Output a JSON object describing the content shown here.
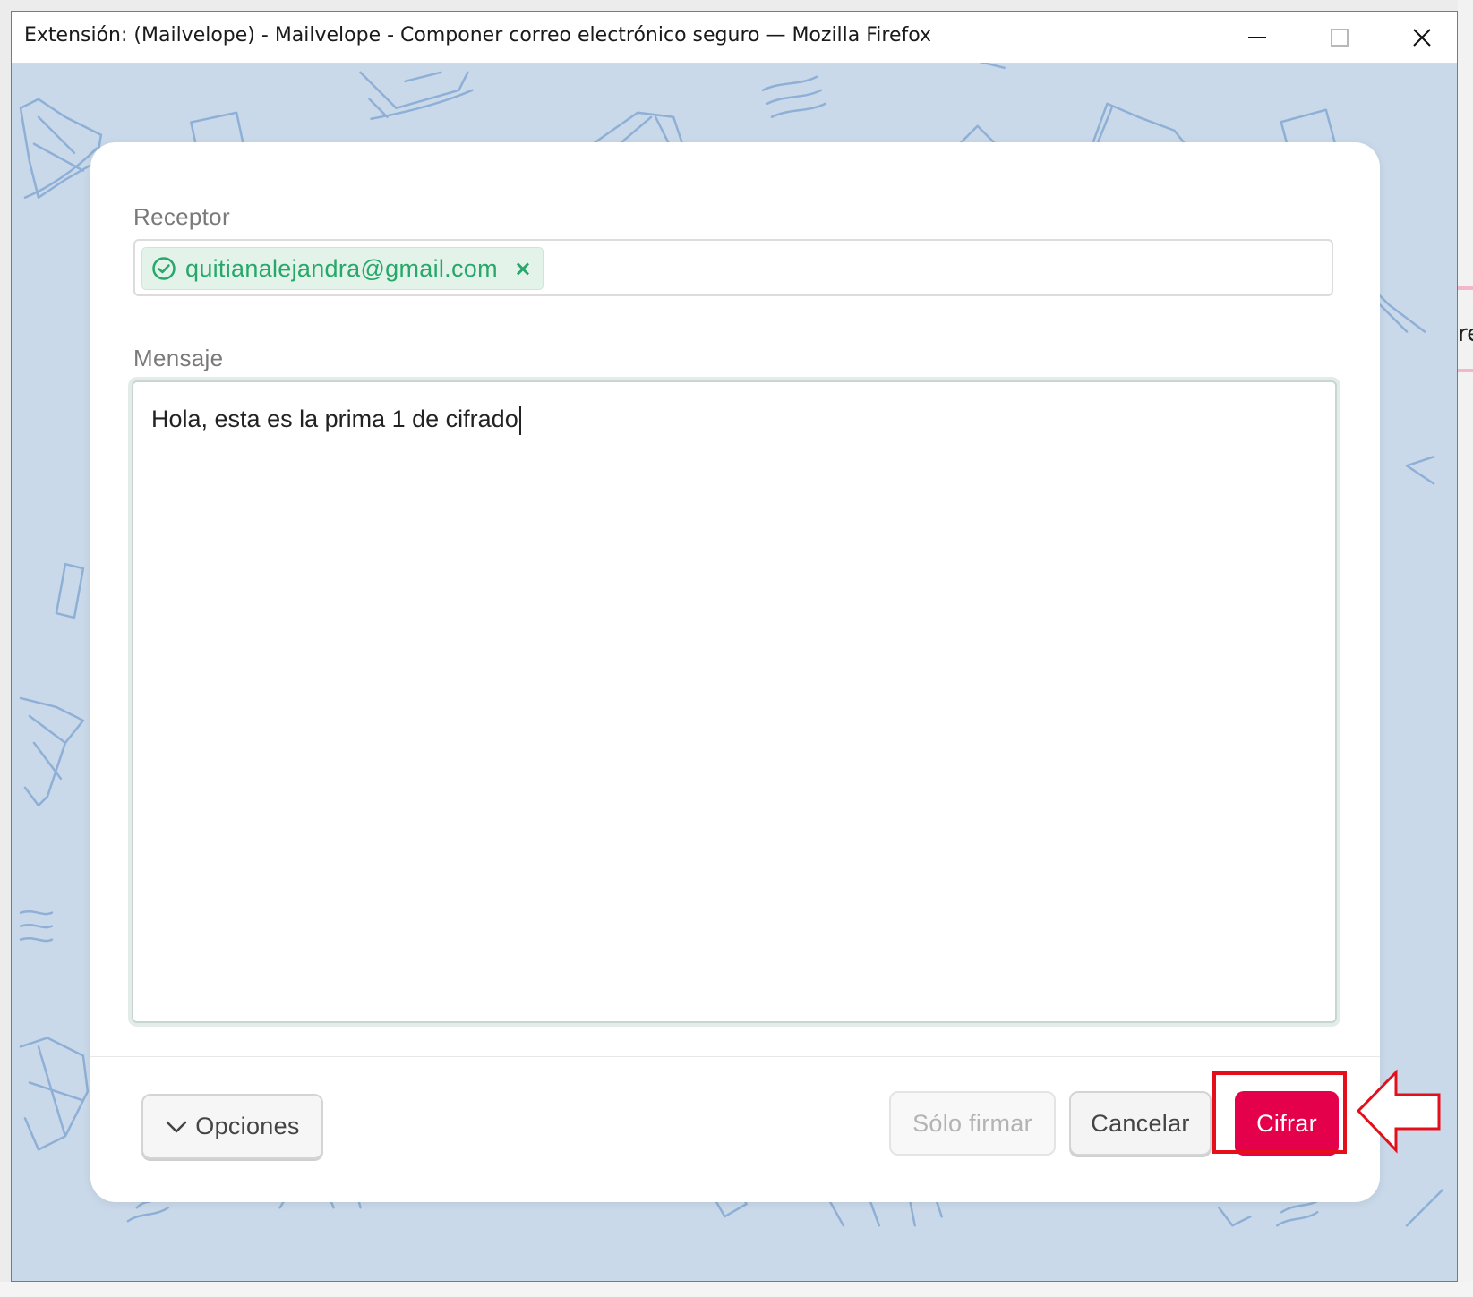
{
  "window": {
    "title": "Extensión: (Mailvelope) - Mailvelope - Componer correo electrónico seguro — Mozilla Firefox",
    "controls": {
      "minimize_icon": "minimize-icon",
      "maximize_icon": "maximize-icon",
      "close_icon": "close-icon"
    }
  },
  "background_partial_text": "re",
  "form": {
    "recipient_label": "Receptor",
    "recipients": [
      {
        "email": "quitianalejandra@gmail.com",
        "verified": true
      }
    ],
    "message_label": "Mensaje",
    "message_text": "Hola, esta es la prima 1 de cifrado"
  },
  "footer": {
    "options_label": "Opciones",
    "sign_only_label": "Sólo firmar",
    "cancel_label": "Cancelar",
    "encrypt_label": "Cifrar"
  },
  "colors": {
    "accent": "#e4004b",
    "success": "#27a86a",
    "background_pattern": "#c9d9ea",
    "annotation": "#e3101b"
  }
}
